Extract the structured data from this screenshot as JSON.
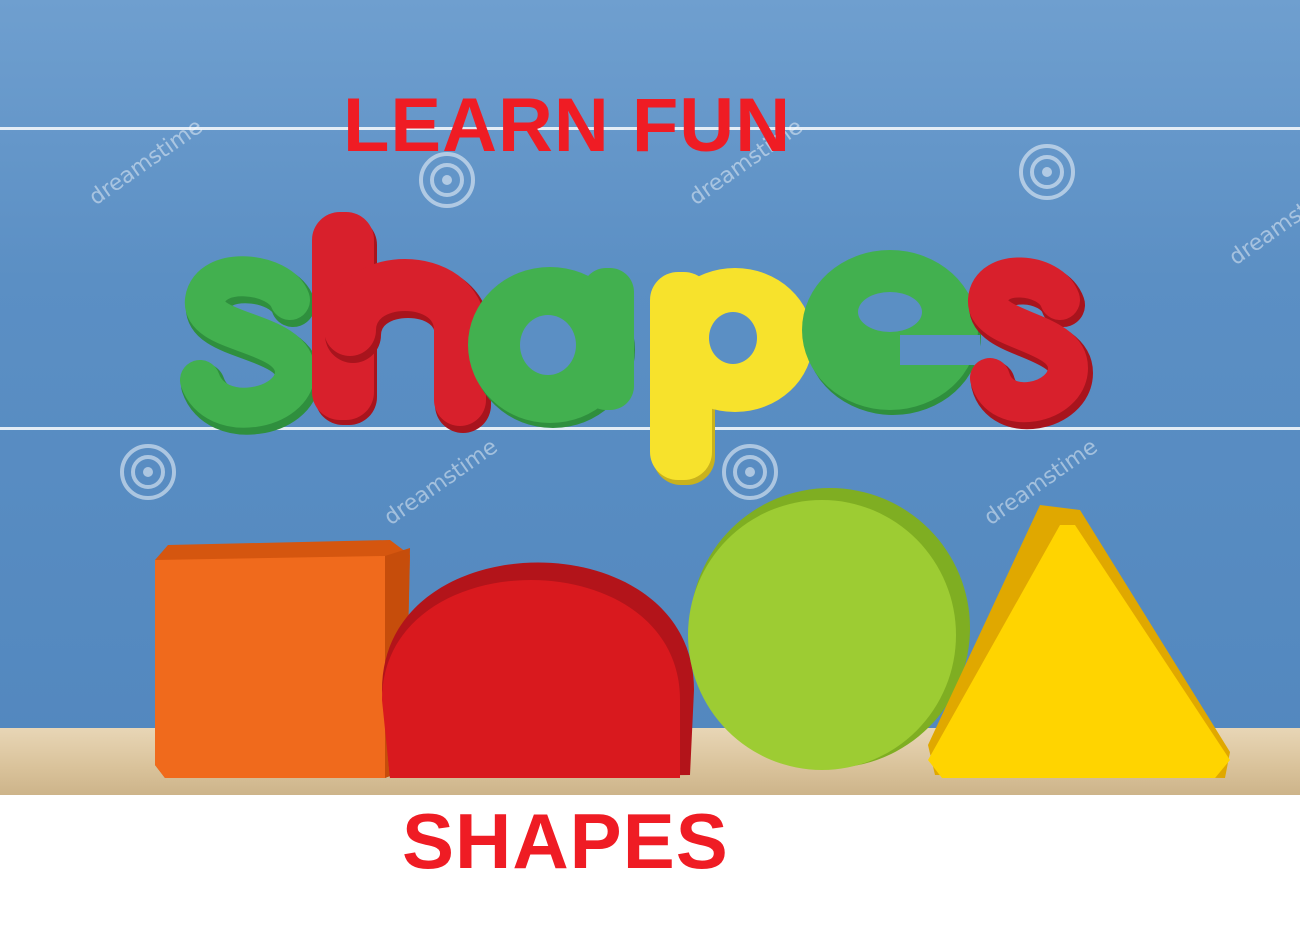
{
  "headline": "LEARN FUN",
  "magnet_word": "shapes",
  "caption": "SHAPES",
  "watermark": "dreamstime",
  "colors": {
    "board": "#5b8fc4",
    "text_red": "#ef1c24",
    "magnet_green": "#3aa84a",
    "magnet_red": "#d8202c",
    "magnet_yellow": "#f7e22c",
    "block_orange": "#f06a1c",
    "block_red": "#d9191e",
    "block_green": "#9dcc33",
    "block_yellow": "#ffd400"
  },
  "blocks": [
    "square-block",
    "half-circle-block",
    "circle-block",
    "triangle-block"
  ]
}
